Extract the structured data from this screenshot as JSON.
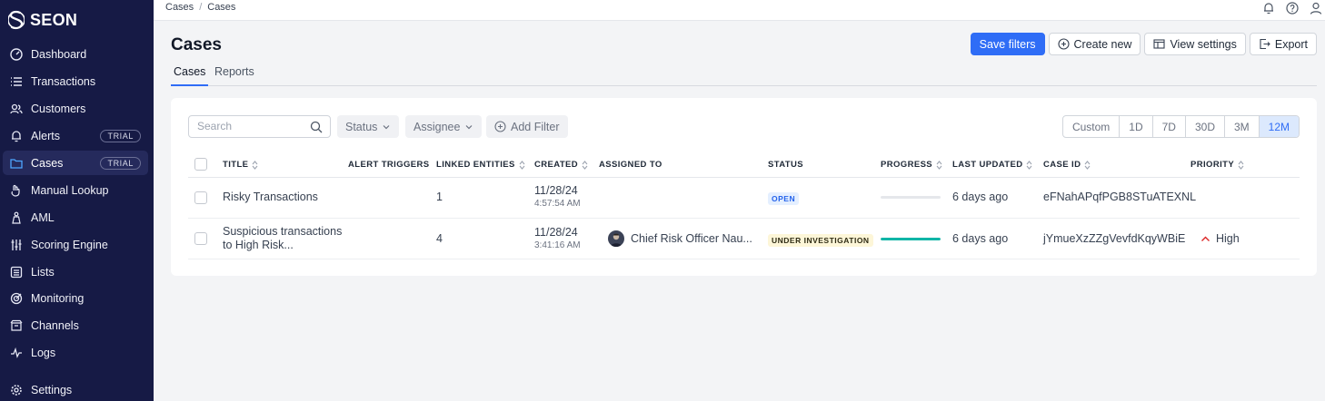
{
  "sidebar": {
    "brand": "SEON",
    "items": [
      {
        "label": "Dashboard",
        "icon": "dashboard-icon"
      },
      {
        "label": "Transactions",
        "icon": "list-icon"
      },
      {
        "label": "Customers",
        "icon": "customers-icon"
      },
      {
        "label": "Alerts",
        "icon": "bell-icon",
        "badge": "TRIAL"
      },
      {
        "label": "Cases",
        "icon": "folder-icon",
        "badge": "TRIAL",
        "active": true
      },
      {
        "label": "Manual Lookup",
        "icon": "hand-icon"
      },
      {
        "label": "AML",
        "icon": "bank-icon"
      },
      {
        "label": "Scoring Engine",
        "icon": "sliders-icon"
      },
      {
        "label": "Lists",
        "icon": "lists-icon"
      },
      {
        "label": "Monitoring",
        "icon": "monitoring-icon"
      },
      {
        "label": "Channels",
        "icon": "channels-icon"
      },
      {
        "label": "Logs",
        "icon": "logs-icon"
      },
      {
        "label": "Settings",
        "icon": "gear-icon"
      }
    ]
  },
  "topbar": {
    "breadcrumb": [
      "Cases",
      "Cases"
    ],
    "separator": "/"
  },
  "header": {
    "title": "Cases",
    "buttons": {
      "save_filters": "Save filters",
      "create_new": "Create new",
      "view_settings": "View settings",
      "export": "Export"
    }
  },
  "tabs": [
    "Cases",
    "Reports"
  ],
  "filters": {
    "search_placeholder": "Search",
    "status": "Status",
    "assignee": "Assignee",
    "add_filter": "Add Filter"
  },
  "date_range": {
    "options": [
      "Custom",
      "1D",
      "7D",
      "30D",
      "3M",
      "12M"
    ],
    "selected": "12M"
  },
  "table": {
    "columns": [
      "TITLE",
      "ALERT TRIGGERS",
      "LINKED ENTITIES",
      "CREATED",
      "ASSIGNED TO",
      "STATUS",
      "PROGRESS",
      "LAST UPDATED",
      "CASE ID",
      "PRIORITY"
    ],
    "rows": [
      {
        "title_line1": "Risky Transactions",
        "title_line2": "",
        "linked_entities": "1",
        "created_date": "11/28/24",
        "created_time": "4:57:54 AM",
        "assigned_to": "",
        "status": "OPEN",
        "progress": 0,
        "last_updated": "6 days ago",
        "case_id": "eFNahAPqfPGB8STuATEXNL",
        "priority": ""
      },
      {
        "title_line1": "Suspicious transactions",
        "title_line2": "to High Risk...",
        "linked_entities": "4",
        "created_date": "11/28/24",
        "created_time": "3:41:16 AM",
        "assigned_to": "Chief Risk Officer Nau...",
        "status": "UNDER INVESTIGATION",
        "progress": 1.0,
        "last_updated": "6 days ago",
        "case_id": "jYmueXzZZgVevfdKqyWBiE",
        "priority": "High"
      }
    ]
  },
  "colors": {
    "sidebar_bg": "#161a45",
    "primary": "#2f6df6",
    "progress_fill": "#10b5a7",
    "priority_high": "#dc2626"
  }
}
